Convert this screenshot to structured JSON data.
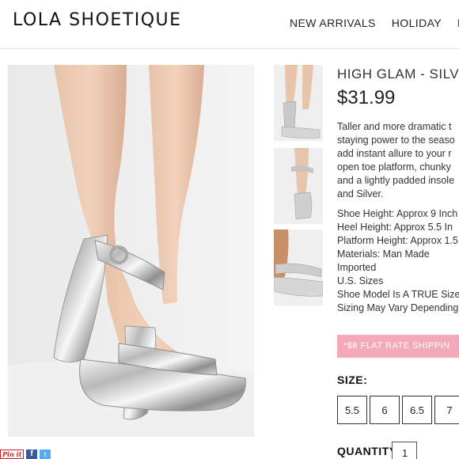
{
  "header": {
    "logo": "LOLA SHOETIQUE",
    "nav": [
      "NEW ARRIVALS",
      "HOLIDAY",
      "FA"
    ]
  },
  "product": {
    "title": "HIGH GLAM - SILV",
    "price": "$31.99",
    "description_lines": [
      "Taller and more dramatic t",
      "staying power to the seaso",
      "add instant allure to  your r",
      "open toe platform, chunky",
      "and a lightly padded insole",
      "and Silver."
    ],
    "specs": [
      "Shoe Height: Approx 9 Inch",
      "Heel Height: Approx 5.5 In",
      "Platform Height: Approx 1.5",
      "Materials: Man Made",
      "Imported",
      "U.S. Sizes",
      "Shoe Model Is A TRUE Size",
      "Sizing May Vary Depending"
    ],
    "shipping_banner": "*$8 FLAT RATE SHIPPIN"
  },
  "size": {
    "label": "SIZE:",
    "options": [
      "5.5",
      "6",
      "6.5",
      "7"
    ]
  },
  "quantity": {
    "label": "QUANTITY:",
    "value": "1"
  },
  "social": {
    "pinterest": "Pin it",
    "facebook": "f",
    "twitter": "t"
  },
  "colors": {
    "shipping_banner": "#f3a9b8",
    "pinterest": "#cb2027",
    "facebook": "#3b5998",
    "twitter": "#55acee"
  }
}
